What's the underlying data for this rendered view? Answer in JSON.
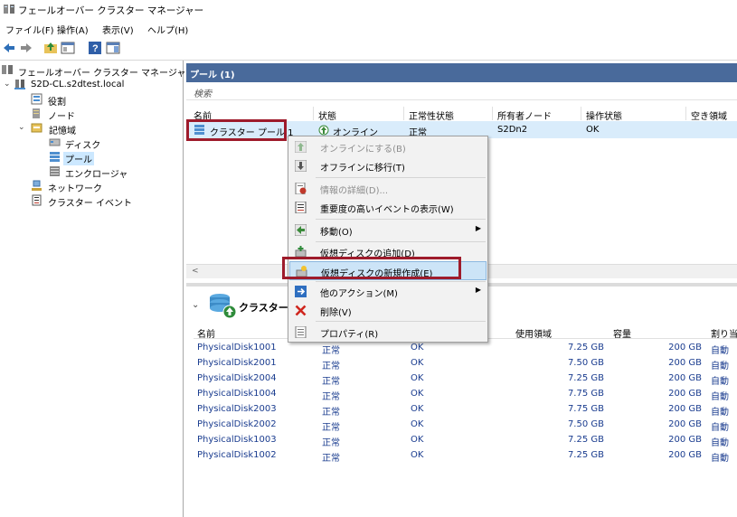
{
  "window": {
    "title": "フェールオーバー クラスター マネージャー"
  },
  "menu": [
    "ファイル(F)",
    "操作(A)",
    "表示(V)",
    "ヘルプ(H)"
  ],
  "tree": {
    "root": "フェールオーバー クラスター マネージャー",
    "cluster": "S2D-CL.s2dtest.local",
    "roles": "役割",
    "nodes": "ノード",
    "storage": "記憶域",
    "disks": "ディスク",
    "pools": "プール",
    "enclosures": "エンクロージャ",
    "network": "ネットワーク",
    "events": "クラスター イベント"
  },
  "pools_pane": {
    "header": "プール (1)",
    "search_placeholder": "検索",
    "columns": [
      "名前",
      "状態",
      "正常性状態",
      "所有者ノード",
      "操作状態",
      "空き領域"
    ],
    "row": {
      "name": "クラスター プール 1",
      "state": "オンライン",
      "health": "正常",
      "owner": "S2Dn2",
      "op": "OK"
    }
  },
  "context_menu": [
    {
      "label": "オンラインにする(B)",
      "icon": "online-icon",
      "disabled": true
    },
    {
      "label": "オフラインに移行(T)",
      "icon": "offline-icon",
      "disabled": false
    },
    {
      "label": "情報の詳細(D)...",
      "icon": "info-icon",
      "disabled": true
    },
    {
      "label": "重要度の高いイベントの表示(W)",
      "icon": "event-icon",
      "disabled": false
    },
    {
      "label": "移動(O)",
      "icon": "move-icon",
      "disabled": false,
      "submenu": true
    },
    {
      "label": "仮想ディスクの追加(D)",
      "icon": "add-disk-icon",
      "disabled": false
    },
    {
      "label": "仮想ディスクの新規作成(E)",
      "icon": "new-disk-icon",
      "disabled": false,
      "highlighted": true
    },
    {
      "label": "他のアクション(M)",
      "icon": "more-actions-icon",
      "disabled": false,
      "submenu": true
    },
    {
      "label": "削除(V)",
      "icon": "delete-icon",
      "disabled": false
    },
    {
      "label": "プロパティ(R)",
      "icon": "properties-icon",
      "disabled": false
    }
  ],
  "detail_pane": {
    "title": "クラスター プ",
    "columns": [
      "名前",
      "使用領域",
      "容量",
      "割り当"
    ],
    "disks": [
      {
        "name": "PhysicalDisk1001",
        "state": "正常",
        "health": "OK",
        "used": "7.25 GB",
        "capacity": "200 GB",
        "alloc": "自動"
      },
      {
        "name": "PhysicalDisk2001",
        "state": "正常",
        "health": "OK",
        "used": "7.50 GB",
        "capacity": "200 GB",
        "alloc": "自動"
      },
      {
        "name": "PhysicalDisk2004",
        "state": "正常",
        "health": "OK",
        "used": "7.25 GB",
        "capacity": "200 GB",
        "alloc": "自動"
      },
      {
        "name": "PhysicalDisk1004",
        "state": "正常",
        "health": "OK",
        "used": "7.75 GB",
        "capacity": "200 GB",
        "alloc": "自動"
      },
      {
        "name": "PhysicalDisk2003",
        "state": "正常",
        "health": "OK",
        "used": "7.75 GB",
        "capacity": "200 GB",
        "alloc": "自動"
      },
      {
        "name": "PhysicalDisk2002",
        "state": "正常",
        "health": "OK",
        "used": "7.50 GB",
        "capacity": "200 GB",
        "alloc": "自動"
      },
      {
        "name": "PhysicalDisk1003",
        "state": "正常",
        "health": "OK",
        "used": "7.25 GB",
        "capacity": "200 GB",
        "alloc": "自動"
      },
      {
        "name": "PhysicalDisk1002",
        "state": "正常",
        "health": "OK",
        "used": "7.25 GB",
        "capacity": "200 GB",
        "alloc": "自動"
      }
    ]
  },
  "colors": {
    "header_blue": "#496a9b",
    "highlight_red": "#9e1b2b",
    "selection": "#d9ecfb",
    "link_blue": "#1a3c8f"
  }
}
